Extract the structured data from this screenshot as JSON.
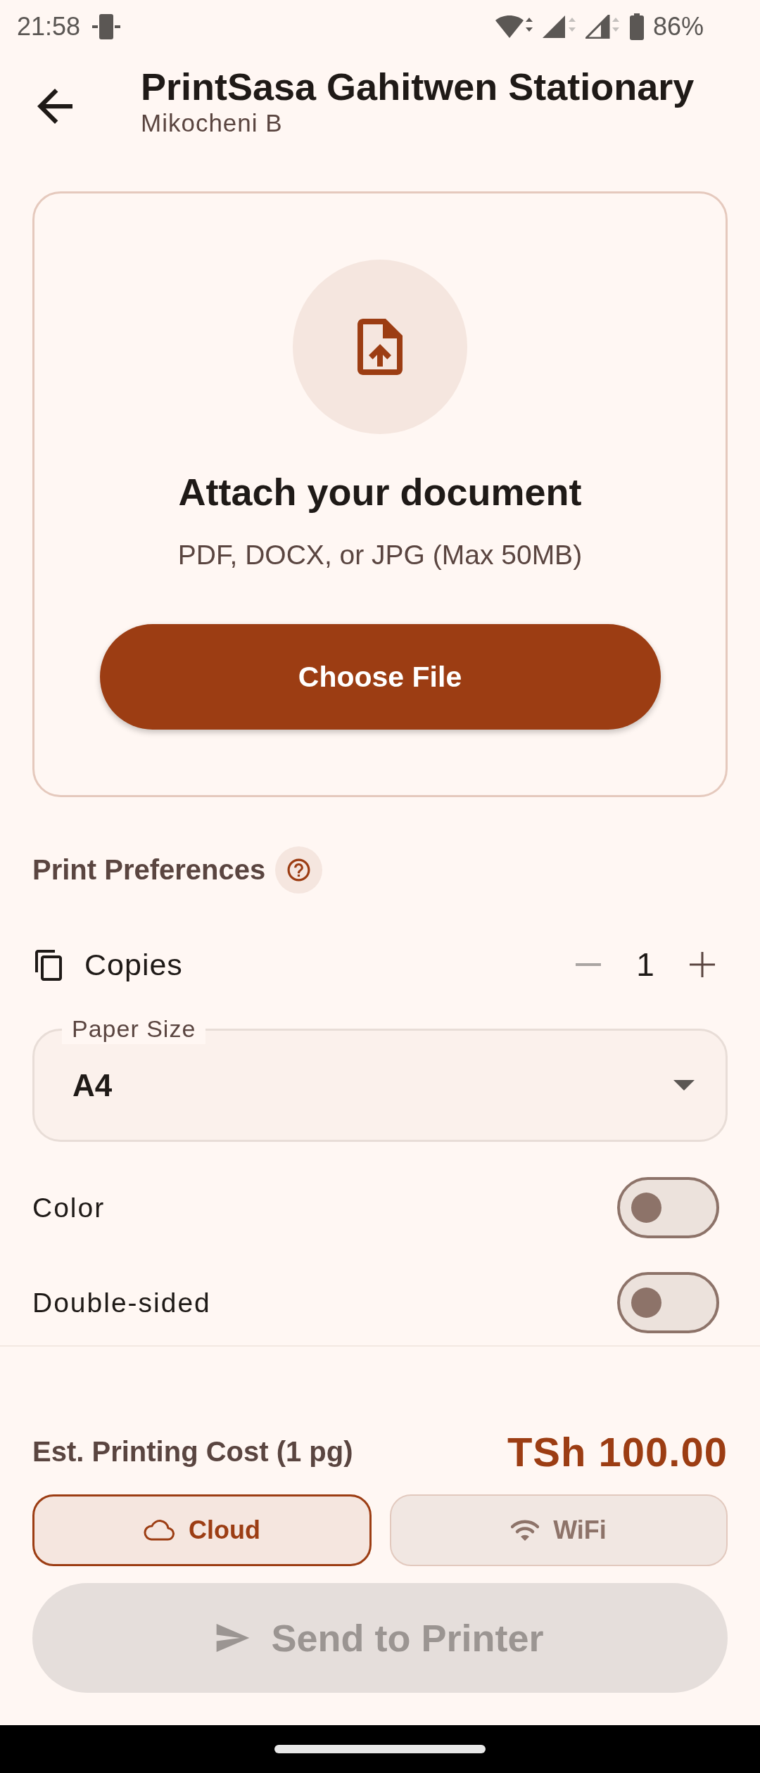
{
  "status_bar": {
    "time": "21:58",
    "battery": "86%"
  },
  "header": {
    "title": "PrintSasa Gahitwen Stationary",
    "subtitle": "Mikocheni B"
  },
  "upload": {
    "title": "Attach your document",
    "hint": "PDF, DOCX, or JPG (Max 50MB)",
    "button": "Choose File"
  },
  "preferences": {
    "title": "Print Preferences",
    "copies": {
      "label": "Copies",
      "value": "1",
      "decrement_disabled": true
    },
    "paper_size": {
      "label": "Paper Size",
      "value": "A4"
    },
    "toggles": [
      {
        "label": "Color",
        "on": false
      },
      {
        "label": "Double-sided",
        "on": false
      }
    ]
  },
  "cost": {
    "label": "Est. Printing Cost (1 pg)",
    "value": "TSh 100.00"
  },
  "connection_tabs": [
    {
      "kind": "cloud",
      "label": "Cloud",
      "selected": true
    },
    {
      "kind": "wifi",
      "label": "WiFi",
      "selected": false
    }
  ],
  "send_button": {
    "label": "Send to Printer",
    "disabled": true
  }
}
